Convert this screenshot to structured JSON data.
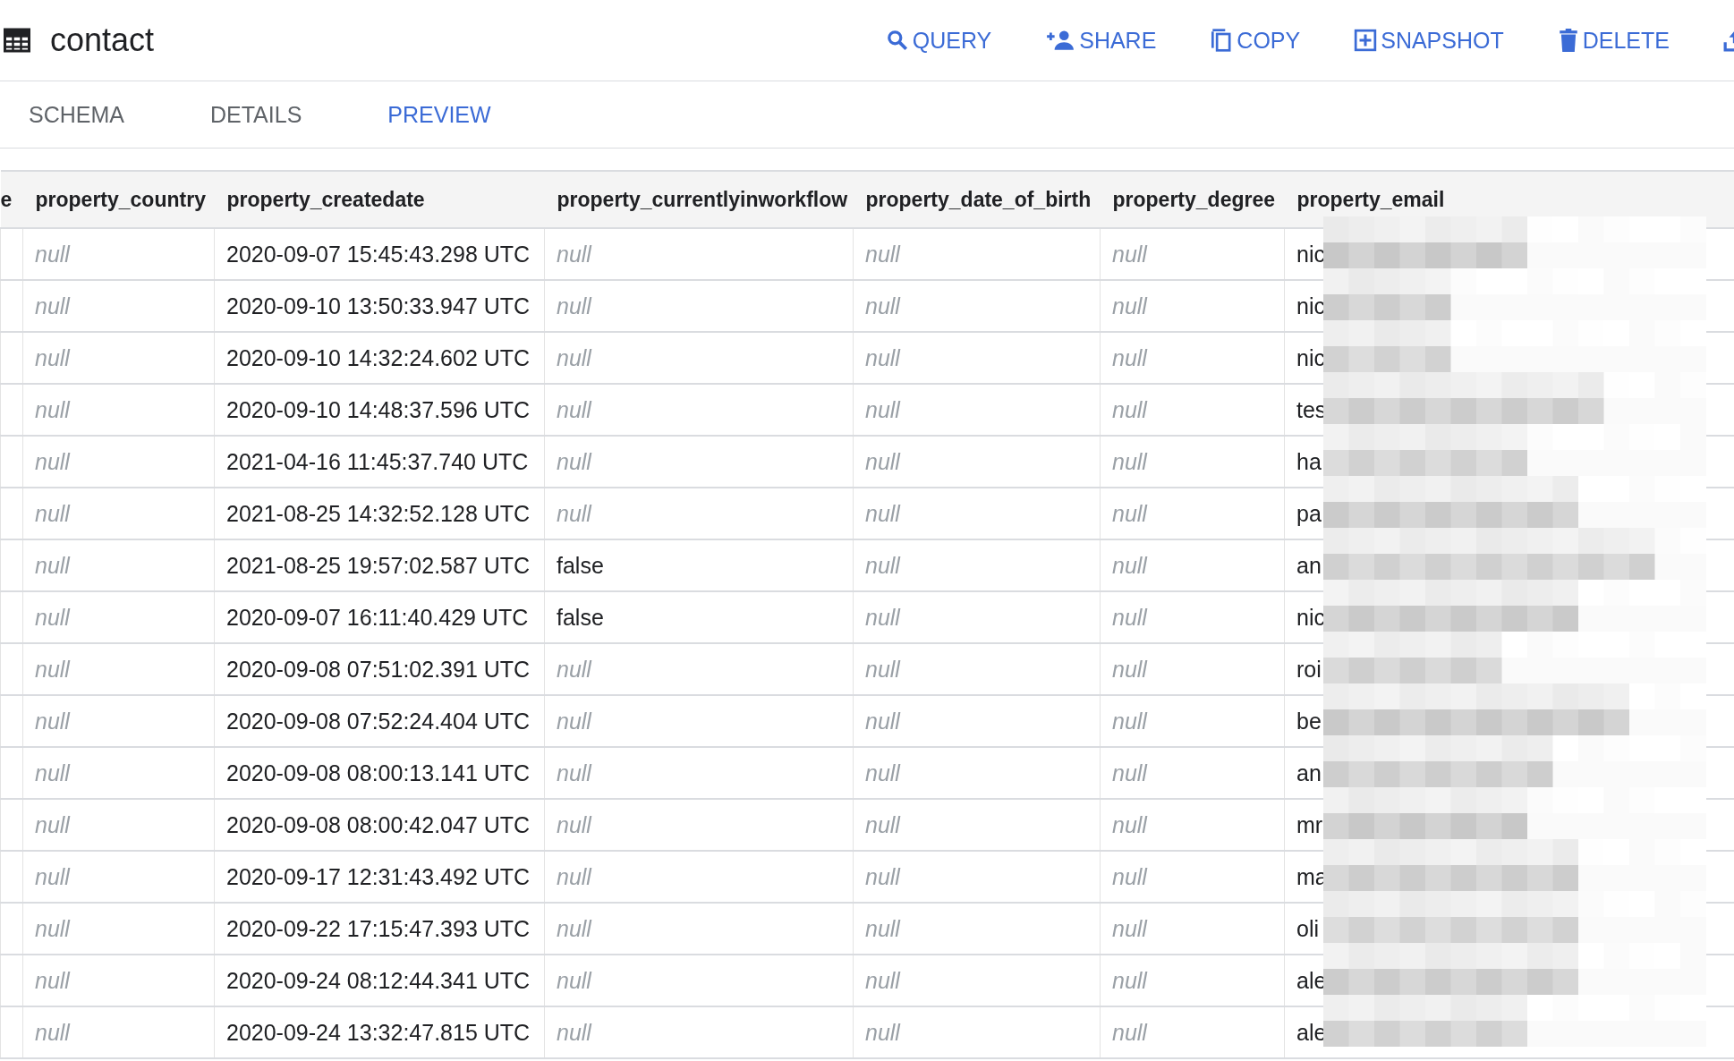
{
  "header": {
    "title": "contact",
    "actions": [
      {
        "label": "QUERY",
        "kind": "query"
      },
      {
        "label": "SHARE",
        "kind": "share"
      },
      {
        "label": "COPY",
        "kind": "copy"
      },
      {
        "label": "SNAPSHOT",
        "kind": "snapshot"
      },
      {
        "label": "DELETE",
        "kind": "delete"
      },
      {
        "kind": "export"
      }
    ]
  },
  "tabs": [
    {
      "label": "SCHEMA",
      "selected": false
    },
    {
      "label": "DETAILS",
      "selected": false
    },
    {
      "label": "PREVIEW",
      "selected": true
    }
  ],
  "table": {
    "columns": [
      "e",
      "property_country",
      "property_createdate",
      "property_currentlyinworkflow",
      "property_date_of_birth",
      "property_degree",
      "property_email"
    ],
    "rows": [
      [
        "",
        "null",
        "2020-09-07 15:45:43.298 UTC",
        "null",
        "null",
        "null",
        "nic"
      ],
      [
        "",
        "null",
        "2020-09-10 13:50:33.947 UTC",
        "null",
        "null",
        "null",
        "nic"
      ],
      [
        "",
        "null",
        "2020-09-10 14:32:24.602 UTC",
        "null",
        "null",
        "null",
        "nic"
      ],
      [
        "",
        "null",
        "2020-09-10 14:48:37.596 UTC",
        "null",
        "null",
        "null",
        "tes"
      ],
      [
        "",
        "null",
        "2021-04-16 11:45:37.740 UTC",
        "null",
        "null",
        "null",
        "ha"
      ],
      [
        "",
        "null",
        "2021-08-25 14:32:52.128 UTC",
        "null",
        "null",
        "null",
        "pa"
      ],
      [
        "",
        "null",
        "2021-08-25 19:57:02.587 UTC",
        "false",
        "null",
        "null",
        "an"
      ],
      [
        "",
        "null",
        "2020-09-07 16:11:40.429 UTC",
        "false",
        "null",
        "null",
        "nic"
      ],
      [
        "",
        "null",
        "2020-09-08 07:51:02.391 UTC",
        "null",
        "null",
        "null",
        "roi"
      ],
      [
        "",
        "null",
        "2020-09-08 07:52:24.404 UTC",
        "null",
        "null",
        "null",
        "be"
      ],
      [
        "",
        "null",
        "2020-09-08 08:00:13.141 UTC",
        "null",
        "null",
        "null",
        "an"
      ],
      [
        "",
        "null",
        "2020-09-08 08:00:42.047 UTC",
        "null",
        "null",
        "null",
        "mr"
      ],
      [
        "",
        "null",
        "2020-09-17 12:31:43.492 UTC",
        "null",
        "null",
        "null",
        "ma"
      ],
      [
        "",
        "null",
        "2020-09-22 17:15:47.393 UTC",
        "null",
        "null",
        "null",
        "oli"
      ],
      [
        "",
        "null",
        "2020-09-24 08:12:44.341 UTC",
        "null",
        "null",
        "null",
        "ale"
      ],
      [
        "",
        "null",
        "2020-09-24 13:32:47.815 UTC",
        "null",
        "null",
        "null",
        "ale"
      ]
    ]
  }
}
